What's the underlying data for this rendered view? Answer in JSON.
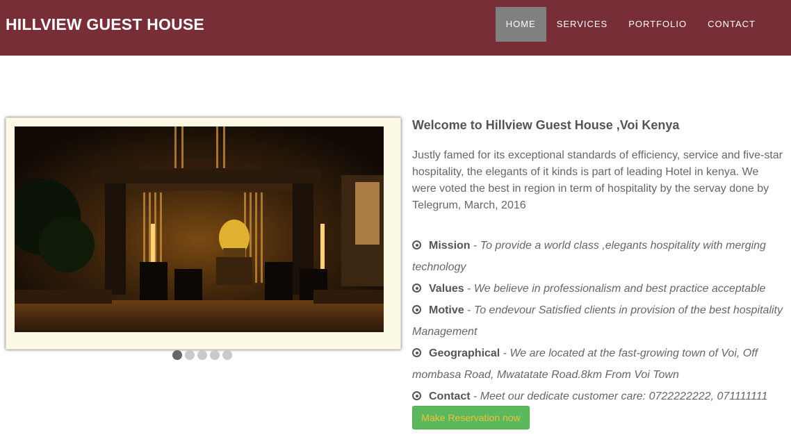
{
  "header": {
    "brand": "HILLVIEW GUEST HOUSE",
    "nav": [
      {
        "label": "HOME",
        "active": true
      },
      {
        "label": "SERVICES",
        "active": false
      },
      {
        "label": "PORTFOLIO",
        "active": false
      },
      {
        "label": "CONTACT",
        "active": false
      }
    ]
  },
  "slider": {
    "image": "hotel-lobby-night-photo",
    "slide_count": 5,
    "active_slide": 1
  },
  "main": {
    "title": "Welcome to Hillview Guest House ,Voi Kenya",
    "intro": "Justly famed for its exceptional standards of efficiency, service and five-star hospitality, the elegants of it kinds is part of leading Hotel in kenya. We were voted the best in region in term of hospitality by the servay done by Telegrum, March, 2016",
    "items": [
      {
        "label": "Mission",
        "text": "To provide a world class ,elegants hospitality with merging technology"
      },
      {
        "label": "Values",
        "text": "We believe in professionalism and best practice acceptable"
      },
      {
        "label": "Motive",
        "text": "To endevour Satisfied clients in provision of the best hospitality Management"
      },
      {
        "label": "Geographical",
        "text": "We are located at the fast-growing town of Voi, Off mombasa Road, Mwatatate Road.8km From Voi Town"
      },
      {
        "label": "Contact",
        "text": "Meet our dedicate customer care: 0722222222, 071111111"
      }
    ],
    "separator": " - ",
    "reserve_button": "Make Reservation now"
  },
  "colors": {
    "navbar": "#772e36",
    "nav_active": "#808080",
    "button": "#5cb85c",
    "button_text": "#f0c040"
  }
}
